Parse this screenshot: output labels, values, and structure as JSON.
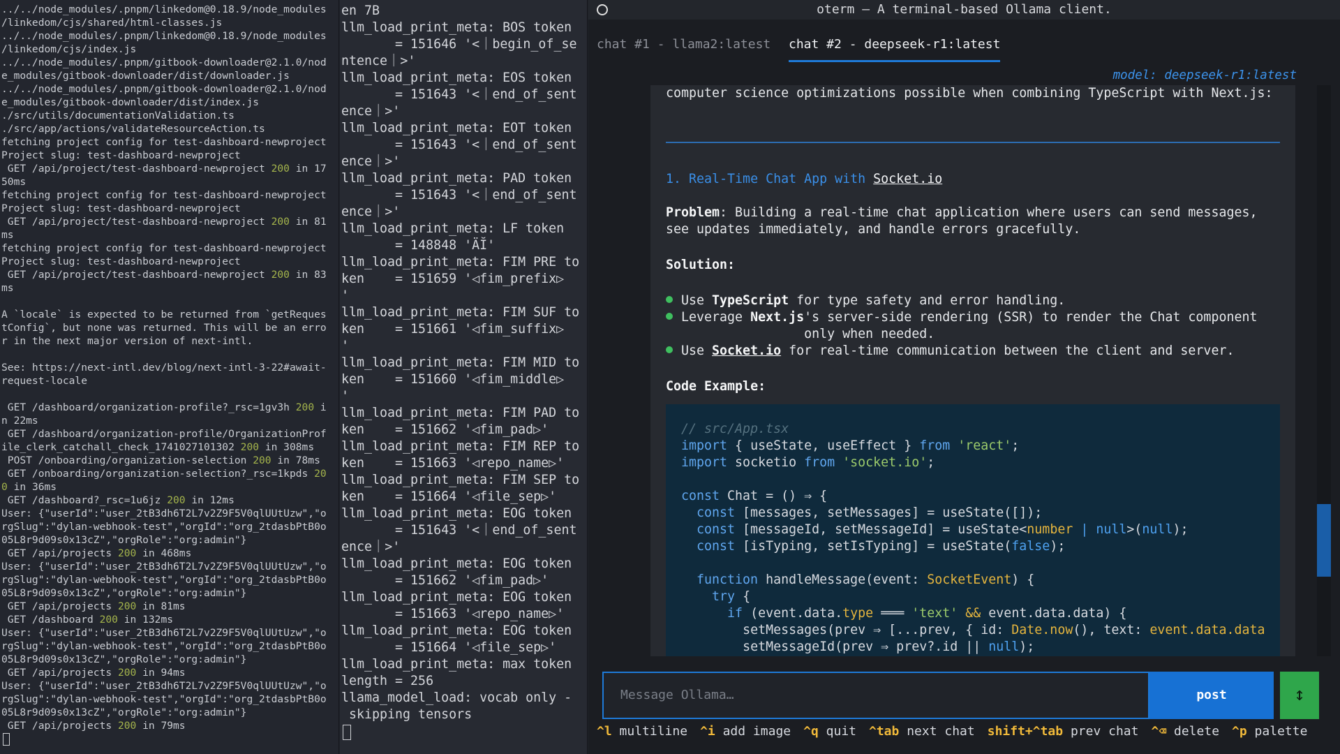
{
  "pane1": {
    "lines": [
      "../../node_modules/.pnpm/linkedom@0.18.9/node_modules",
      "/linkedom/cjs/shared/html-classes.js",
      "../../node_modules/.pnpm/linkedom@0.18.9/node_modules",
      "/linkedom/cjs/index.js",
      "../../node_modules/.pnpm/gitbook-downloader@2.1.0/nod",
      "e_modules/gitbook-downloader/dist/downloader.js",
      "../../node_modules/.pnpm/gitbook-downloader@2.1.0/nod",
      "e_modules/gitbook-downloader/dist/index.js",
      "./src/utils/documentationValidation.ts",
      "./src/app/actions/validateResourceAction.ts",
      "fetching project config for test-dashboard-newproject",
      "Project slug: test-dashboard-newproject",
      {
        "pre": " GET /api/project/test-dashboard-newproject ",
        "num": "200",
        "post": " in 17"
      },
      "50ms",
      "fetching project config for test-dashboard-newproject",
      "Project slug: test-dashboard-newproject",
      {
        "pre": " GET /api/project/test-dashboard-newproject ",
        "num": "200",
        "post": " in 81"
      },
      "ms",
      "fetching project config for test-dashboard-newproject",
      "Project slug: test-dashboard-newproject",
      {
        "pre": " GET /api/project/test-dashboard-newproject ",
        "num": "200",
        "post": " in 83"
      },
      "ms",
      "",
      "A `locale` is expected to be returned from `getReques",
      "tConfig`, but none was returned. This will be an erro",
      "r in the next major version of next-intl.",
      "",
      "See: https://next-intl.dev/blog/next-intl-3-22#await-",
      "request-locale",
      "",
      {
        "pre": " GET /dashboard/organization-profile?_rsc=1gv3h ",
        "num": "200",
        "post": " i"
      },
      "n 22ms",
      " GET /dashboard/organization-profile/OrganizationProf",
      {
        "pre": "ile_clerk_catchall_check_1741027101302 ",
        "num": "200",
        "post": " in 308ms"
      },
      {
        "pre": " POST /onboarding/organization-selection ",
        "num": "200",
        "post": " in 78ms"
      },
      {
        "pre": " GET /onboarding/organization-selection?_rsc=1kpds ",
        "num": "20",
        "post": ""
      },
      {
        "pre": "",
        "num": "0",
        "post": " in 36ms"
      },
      {
        "pre": " GET /dashboard?_rsc=1u6jz ",
        "num": "200",
        "post": " in 12ms"
      },
      "User: {\"userId\":\"user_2tB3dh6T2L7v2Z9F5V0qlUUtUzw\",\"o",
      "rgSlug\":\"dylan-webhook-test\",\"orgId\":\"org_2tdasbPtB0o",
      "05L8r9d09s0x13cZ\",\"orgRole\":\"org:admin\"}",
      {
        "pre": " GET /api/projects ",
        "num": "200",
        "post": " in 468ms"
      },
      "User: {\"userId\":\"user_2tB3dh6T2L7v2Z9F5V0qlUUtUzw\",\"o",
      "rgSlug\":\"dylan-webhook-test\",\"orgId\":\"org_2tdasbPtB0o",
      "05L8r9d09s0x13cZ\",\"orgRole\":\"org:admin\"}",
      {
        "pre": " GET /api/projects ",
        "num": "200",
        "post": " in 81ms"
      },
      {
        "pre": " GET /dashboard ",
        "num": "200",
        "post": " in 132ms"
      },
      "User: {\"userId\":\"user_2tB3dh6T2L7v2Z9F5V0qlUUtUzw\",\"o",
      "rgSlug\":\"dylan-webhook-test\",\"orgId\":\"org_2tdasbPtB0o",
      "05L8r9d09s0x13cZ\",\"orgRole\":\"org:admin\"}",
      {
        "pre": " GET /api/projects ",
        "num": "200",
        "post": " in 94ms"
      },
      "User: {\"userId\":\"user_2tB3dh6T2L7v2Z9F5V0qlUUtUzw\",\"o",
      "rgSlug\":\"dylan-webhook-test\",\"orgId\":\"org_2tdasbPtB0o",
      "05L8r9d09s0x13cZ\",\"orgRole\":\"org:admin\"}",
      {
        "pre": " GET /api/projects ",
        "num": "200",
        "post": " in 79ms"
      }
    ]
  },
  "pane2": {
    "lines": [
      "en 7B",
      "llm_load_print_meta: BOS token",
      "       = 151646 '<｜begin_of_se",
      "ntence｜>'",
      "llm_load_print_meta: EOS token",
      "       = 151643 '<｜end_of_sent",
      "ence｜>'",
      "llm_load_print_meta: EOT token",
      "       = 151643 '<｜end_of_sent",
      "ence｜>'",
      "llm_load_print_meta: PAD token",
      "       = 151643 '<｜end_of_sent",
      "ence｜>'",
      "llm_load_print_meta: LF token",
      "       = 148848 'ÄĬ'",
      "llm_load_print_meta: FIM PRE to",
      "ken    = 151659 '◁fim_prefix▷",
      "'",
      "llm_load_print_meta: FIM SUF to",
      "ken    = 151661 '◁fim_suffix▷",
      "'",
      "llm_load_print_meta: FIM MID to",
      "ken    = 151660 '◁fim_middle▷",
      "'",
      "llm_load_print_meta: FIM PAD to",
      "ken    = 151662 '◁fim_pad▷'",
      "llm_load_print_meta: FIM REP to",
      "ken    = 151663 '◁repo_name▷'",
      "llm_load_print_meta: FIM SEP to",
      "ken    = 151664 '◁file_sep▷'",
      "llm_load_print_meta: EOG token",
      "       = 151643 '<｜end_of_sent",
      "ence｜>'",
      "llm_load_print_meta: EOG token",
      "       = 151662 '◁fim_pad▷'",
      "llm_load_print_meta: EOG token",
      "       = 151663 '◁repo_name▷'",
      "llm_load_print_meta: EOG token",
      "       = 151664 '◁file_sep▷'",
      "llm_load_print_meta: max token",
      "length = 256",
      "llama_model_load: vocab only -",
      " skipping tensors"
    ]
  },
  "oterm": {
    "title": "oterm — A terminal-based Ollama client.",
    "tabs": [
      {
        "label": "chat #1 - llama2:latest"
      },
      {
        "label": "chat #2 - deepseek-r1:latest"
      }
    ],
    "model_label": "model: deepseek-r1:latest",
    "message": {
      "intro": "computer science optimizations possible when combining TypeScript with Next.js:",
      "heading_prefix": "1. Real-Time Chat App with ",
      "heading_link": "Socket.io",
      "problem_label": "Problem",
      "problem_text": ": Building a real-time chat application where users can send messages,\nsee updates immediately, and handle errors gracefully.",
      "solution_label": "Solution:",
      "bullets": [
        {
          "pre": "Use ",
          "strong": "TypeScript",
          "post": " for type safety and error handling."
        },
        {
          "pre": "Leverage ",
          "strong": "Next.js",
          "post": "'s server-side rendering (SSR) to render the Chat component\nonly when needed."
        },
        {
          "pre": "Use ",
          "strong": "Socket.io",
          "post": " for real-time communication between the client and server."
        }
      ],
      "code_label": "Code Example:"
    },
    "input_placeholder": "Message Ollama…",
    "post_label": "post",
    "toggle_symbol": "↕",
    "footer": [
      {
        "key": "^l",
        "label": "multiline"
      },
      {
        "key": "^i",
        "label": "add image"
      },
      {
        "key": "^q",
        "label": "quit"
      },
      {
        "key": "^tab",
        "label": "next chat"
      },
      {
        "key": "shift+^tab",
        "label": "prev chat"
      },
      {
        "key": "^⌫",
        "label": "delete"
      },
      {
        "key": "^p",
        "label": "palette"
      }
    ]
  },
  "code": {
    "comment": "// src/App.tsx",
    "l2_kw1": "import",
    "l2_mid": " { useState, useEffect } ",
    "l2_kw2": "from",
    "l2_str": " 'react'",
    "l2_end": ";",
    "l3_kw1": "import",
    "l3_mid": " socketio ",
    "l3_kw2": "from",
    "l3_str": " 'socket.io'",
    "l3_end": ";",
    "l5_kw": "const",
    "l5_rest": " Chat = () ⇒ {",
    "l6_kw": "const",
    "l6_rest": " [messages, setMessages] = useState([]);",
    "l7_kw": "const",
    "l7_mid": " [messageId, setMessageId] = useState<",
    "l7_typ": "number",
    "l7_pipe": " | ",
    "l7_lit": "null",
    "l7_end": ">(",
    "l7_lit2": "null",
    "l7_close": ");",
    "l8_kw": "const",
    "l8_mid": " [isTyping, setIsTyping] = useState(",
    "l8_lit": "false",
    "l8_end": ");",
    "l10_kw": "function",
    "l10_mid": " handleMessage(event: ",
    "l10_typ": "SocketEvent",
    "l10_end": ") {",
    "l11_kw": "try",
    "l11_end": " {",
    "l12_kw": "if",
    "l12_mid": " (event.data.",
    "l12_prop": "type",
    "l12_op": " ═══ ",
    "l12_str": "'text'",
    "l12_and": " && ",
    "l12_end": "event.data.data) {",
    "l13_a": "setMessages(prev ⇒ [...prev, { id: ",
    "l13_typ": "Date.now",
    "l13_b": "(), text: ",
    "l13_typ2": "event.data.data",
    "l14_a": "setMessageId(prev ⇒ prev?.id || ",
    "l14_lit": "null",
    "l14_b": ");"
  }
}
